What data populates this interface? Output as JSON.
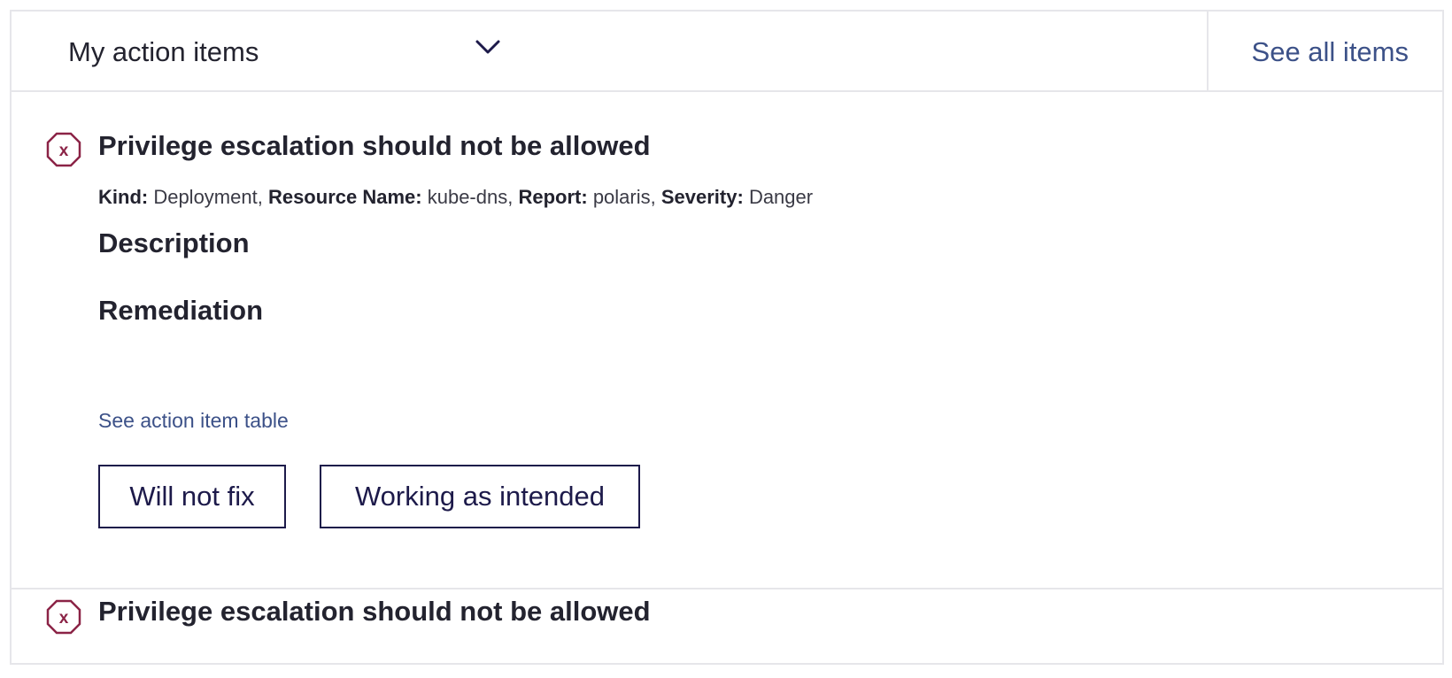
{
  "header": {
    "dropdown_label": "My action items",
    "see_all_label": "See all items"
  },
  "items": [
    {
      "title": "Privilege escalation should not be allowed",
      "kind_label": "Kind:",
      "kind": "Deployment",
      "resource_label": "Resource Name:",
      "resource": "kube-dns",
      "report_label": "Report:",
      "report": "polaris",
      "severity_label": "Severity:",
      "severity": "Danger",
      "description_heading": "Description",
      "remediation_heading": "Remediation",
      "table_link": "See action item table",
      "buttons": {
        "will_not_fix": "Will not fix",
        "working_as_intended": "Working as intended"
      }
    },
    {
      "title": "Privilege escalation should not be allowed"
    }
  ],
  "colors": {
    "danger": "#8b2346",
    "link": "#3c5188",
    "button_border": "#1d1a4a"
  },
  "icons": {
    "dropdown": "chevron-down-icon",
    "severity": "danger-octagon-icon"
  }
}
